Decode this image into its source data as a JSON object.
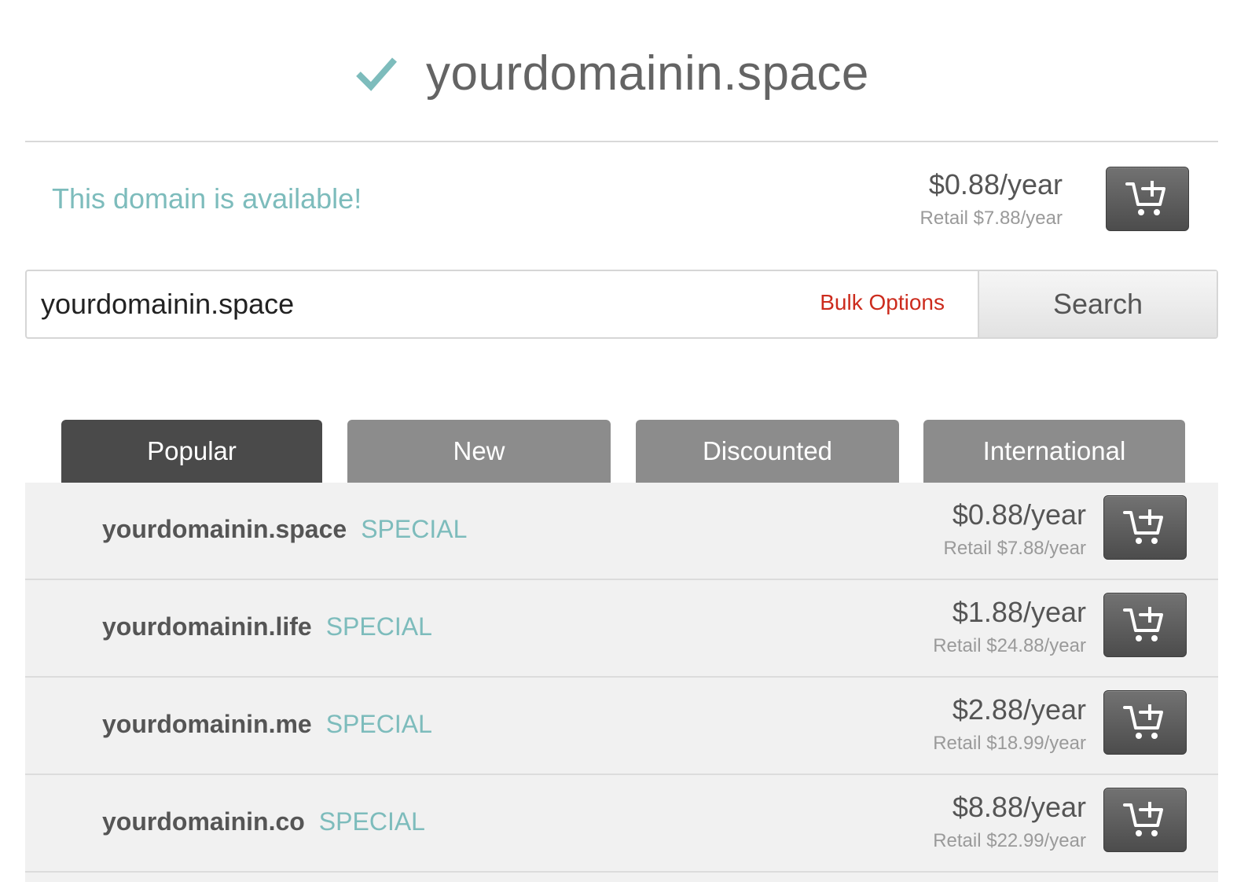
{
  "header": {
    "domain": "yourdomainin.space"
  },
  "availability": {
    "message": "This domain is available!",
    "price": "$0.88/year",
    "retail": "Retail $7.88/year"
  },
  "search": {
    "value": "yourdomainin.space",
    "bulk_options_label": "Bulk Options",
    "button_label": "Search"
  },
  "tabs": [
    {
      "label": "Popular",
      "active": true
    },
    {
      "label": "New",
      "active": false
    },
    {
      "label": "Discounted",
      "active": false
    },
    {
      "label": "International",
      "active": false
    }
  ],
  "results": [
    {
      "domain": "yourdomainin.space",
      "badge": "SPECIAL",
      "price": "$0.88/year",
      "retail": "Retail $7.88/year"
    },
    {
      "domain": "yourdomainin.life",
      "badge": "SPECIAL",
      "price": "$1.88/year",
      "retail": "Retail $24.88/year"
    },
    {
      "domain": "yourdomainin.me",
      "badge": "SPECIAL",
      "price": "$2.88/year",
      "retail": "Retail $18.99/year"
    },
    {
      "domain": "yourdomainin.co",
      "badge": "SPECIAL",
      "price": "$8.88/year",
      "retail": "Retail $22.99/year"
    }
  ],
  "icons": {
    "check": "check-icon",
    "cart": "add-to-cart-icon"
  },
  "colors": {
    "accent_teal": "#7dbcbc",
    "bulk_red": "#cc2b1d",
    "tab_active": "#4a4a4a",
    "tab_inactive": "#8c8c8c",
    "cart_button": "#5c5c5c"
  }
}
